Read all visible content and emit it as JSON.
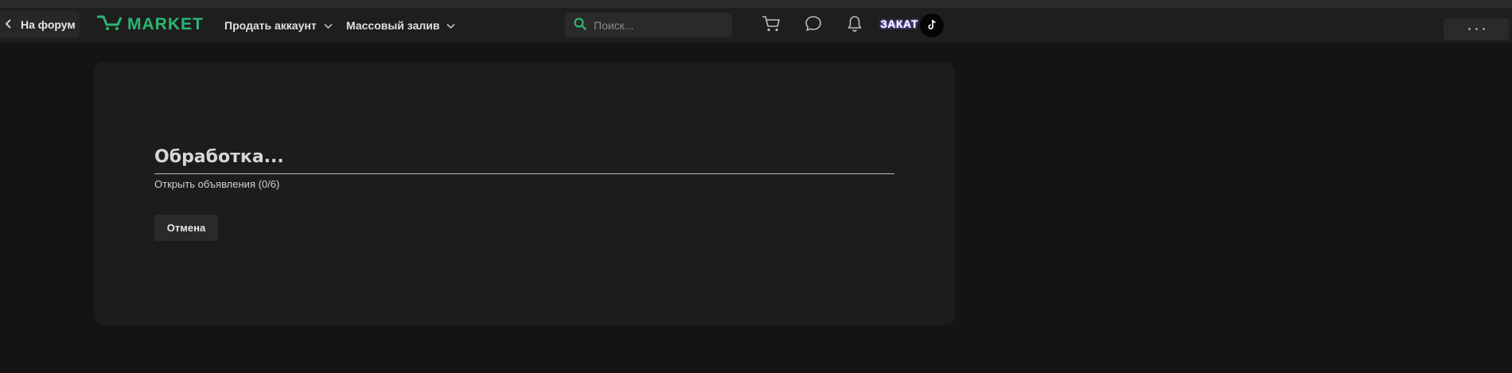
{
  "navbar": {
    "back_label": "На форум",
    "logo_text": "MARKET",
    "menus": [
      {
        "label": "Продать аккаунт"
      },
      {
        "label": "Массовый залив"
      }
    ],
    "search": {
      "value": "",
      "placeholder": "Поиск..."
    },
    "icons": [
      "cart-icon",
      "chat-icon",
      "bell-icon"
    ],
    "promo_label": "ЗАКАТ",
    "avatar_icon": "tiktok-icon"
  },
  "process": {
    "title": "Обработка...",
    "status": "Открыть объявления (0/6)",
    "cancel_label": "Отмена"
  },
  "colors": {
    "brand": "#2bb673",
    "background": "#141414",
    "panel": "#1c1c1c"
  }
}
